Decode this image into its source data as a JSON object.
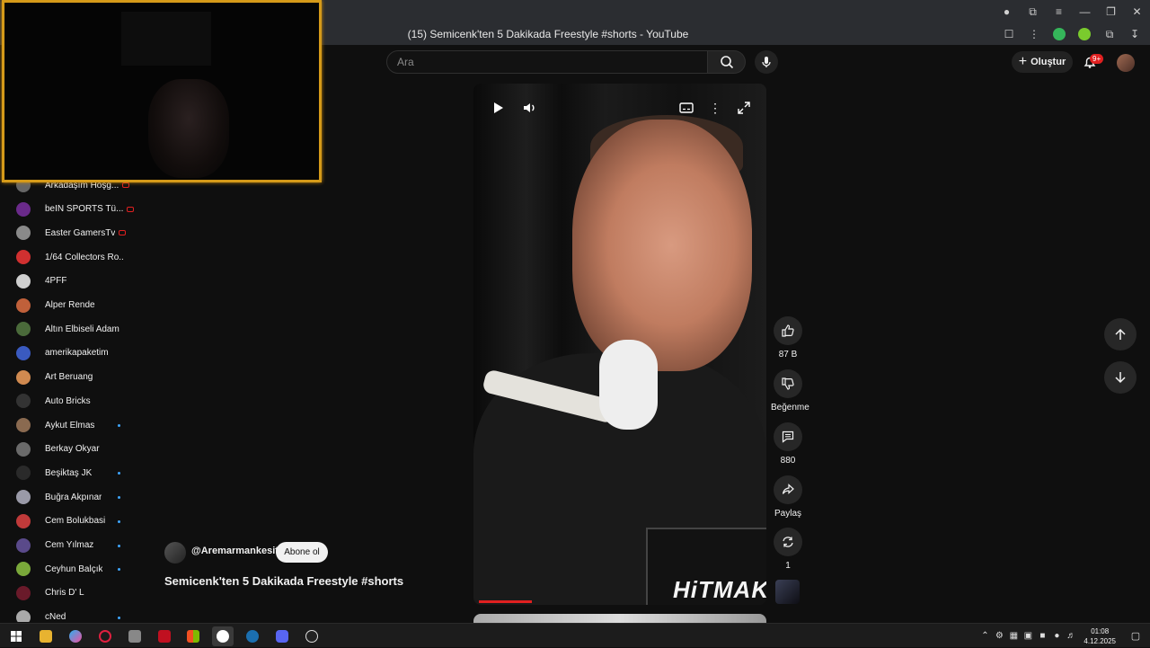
{
  "browser": {
    "tab_title": "(15) Semicenk'ten 5 Dakikada Freestyle #shorts - YouTube"
  },
  "masthead": {
    "search_placeholder": "Ara",
    "create_label": "Oluştur",
    "notification_count": "9+"
  },
  "sidebar": {
    "subscriptions": [
      {
        "name": "Arkadaşım Hoşg...",
        "avatar_color": "#666666",
        "live": true
      },
      {
        "name": "beIN SPORTS Tü...",
        "avatar_color": "#6a2a8a",
        "live": true
      },
      {
        "name": "Easter GamersTv",
        "avatar_color": "#8a8a8a",
        "live": true
      },
      {
        "name": "1/64 Collectors Ro...",
        "avatar_color": "#d03030",
        "live": false
      },
      {
        "name": "4PFF",
        "avatar_color": "#cfcfcf",
        "live": false
      },
      {
        "name": "Alper Rende",
        "avatar_color": "#c0603a",
        "live": false
      },
      {
        "name": "Altın Elbiseli Adam",
        "avatar_color": "#4a6a3a",
        "live": false
      },
      {
        "name": "amerikapaketim",
        "avatar_color": "#3a5ac0",
        "live": false
      },
      {
        "name": "Art Beruang",
        "avatar_color": "#d08a50",
        "live": false
      },
      {
        "name": "Auto Bricks",
        "avatar_color": "#333333",
        "live": false
      },
      {
        "name": "Aykut Elmas",
        "avatar_color": "#8a6a50",
        "live": false,
        "new": true
      },
      {
        "name": "Berkay Okyar",
        "avatar_color": "#6a6a6a",
        "live": false
      },
      {
        "name": "Beşiktaş JK",
        "avatar_color": "#2a2a2a",
        "live": false,
        "new": true
      },
      {
        "name": "Buğra Akpınar",
        "avatar_color": "#9a9aa8",
        "live": false,
        "new": true
      },
      {
        "name": "Cem Bolukbasi",
        "avatar_color": "#c03a3a",
        "live": false,
        "new": true
      },
      {
        "name": "Cem Yılmaz",
        "avatar_color": "#5a4a8a",
        "live": false,
        "new": true
      },
      {
        "name": "Ceyhun Balçık",
        "avatar_color": "#7aa83a",
        "live": false,
        "new": true
      },
      {
        "name": "Chris D' L",
        "avatar_color": "#6a1a2a",
        "live": false
      },
      {
        "name": "cNed",
        "avatar_color": "#aaaaaa",
        "live": false,
        "new": true
      }
    ]
  },
  "short": {
    "channel": "@Aremarmankesit",
    "subscribe_label": "Abone ol",
    "title": "Semicenk'ten 5 Dakikada Freestyle #shorts",
    "overlay_text": "HiTMAKE",
    "progress_fraction": 0.18
  },
  "actions": {
    "like_count": "87 B",
    "dislike_label": "Beğenme",
    "comment_count": "880",
    "share_label": "Paylaş",
    "remix_count": "1"
  },
  "taskbar": {
    "time": "01:08",
    "date": "4.12.2025"
  }
}
